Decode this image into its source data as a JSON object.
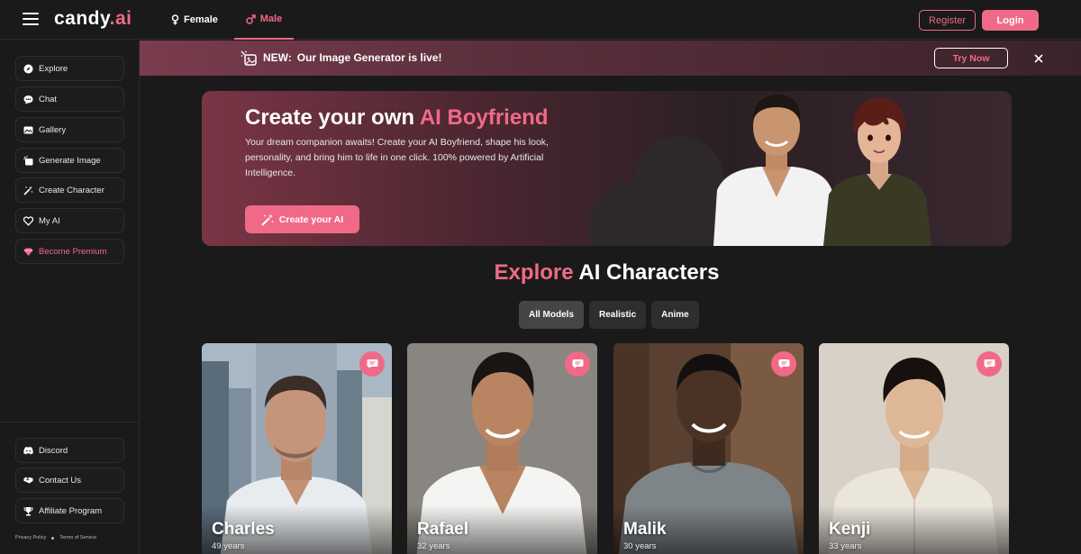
{
  "header": {
    "logo_main": "candy",
    "logo_dot": ".",
    "logo_accent": "ai",
    "tabs": [
      {
        "label": "Female",
        "icon": "female-icon"
      },
      {
        "label": "Male",
        "icon": "male-icon",
        "active": true
      }
    ],
    "register_label": "Register",
    "login_label": "Login"
  },
  "sidebar": {
    "items": [
      {
        "label": "Explore",
        "icon": "compass-icon"
      },
      {
        "label": "Chat",
        "icon": "chat-icon"
      },
      {
        "label": "Gallery",
        "icon": "gallery-icon"
      },
      {
        "label": "Generate Image",
        "icon": "generate-image-icon"
      },
      {
        "label": "Create Character",
        "icon": "magic-wand-icon"
      },
      {
        "label": "My AI",
        "icon": "heart-icon"
      },
      {
        "label": "Become Premium",
        "icon": "diamond-icon"
      }
    ],
    "bottom_items": [
      {
        "label": "Discord",
        "icon": "discord-icon"
      },
      {
        "label": "Contact Us",
        "icon": "handshake-icon"
      },
      {
        "label": "Affiliate Program",
        "icon": "trophy-icon"
      }
    ],
    "privacy_label": "Privacy Policy",
    "terms_label": "Terms of Service"
  },
  "banner": {
    "new_label": "NEW:",
    "text": "Our Image Generator is live!",
    "button_label": "Try Now"
  },
  "hero": {
    "title_prefix": "Create your own",
    "title_accent": "AI Boyfriend",
    "description": "Your dream companion awaits! Create your AI Boyfriend, shape his look, personality, and bring him to life in one click. 100% powered by Artificial Intelligence.",
    "button_label": "Create your AI"
  },
  "explore": {
    "title_accent": "Explore",
    "title_rest": "AI Characters",
    "filters": [
      {
        "label": "All Models",
        "active": true
      },
      {
        "label": "Realistic"
      },
      {
        "label": "Anime"
      }
    ]
  },
  "characters": [
    {
      "name": "Charles",
      "age": "49 years"
    },
    {
      "name": "Rafael",
      "age": "32 years"
    },
    {
      "name": "Malik",
      "age": "30 years"
    },
    {
      "name": "Kenji",
      "age": "33 years"
    }
  ],
  "colors": {
    "accent": "#f06a88",
    "background": "#1a1a1a"
  }
}
